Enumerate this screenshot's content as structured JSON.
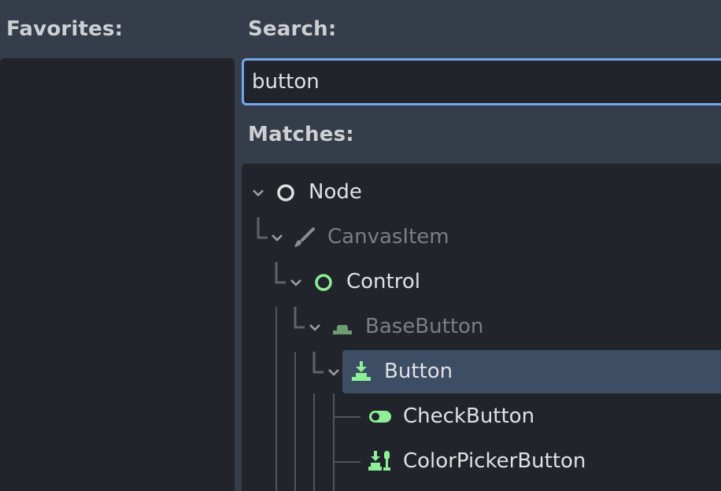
{
  "favorites": {
    "label": "Favorites:"
  },
  "search": {
    "label": "Search:",
    "value": "button"
  },
  "matches": {
    "label": "Matches:",
    "items": [
      {
        "label": "Node",
        "icon": "circle-outline-icon",
        "dim": false
      },
      {
        "label": "CanvasItem",
        "icon": "brush-icon",
        "dim": true
      },
      {
        "label": "Control",
        "icon": "circle-outline-green-icon",
        "dim": false
      },
      {
        "label": "BaseButton",
        "icon": "base-button-icon",
        "dim": true
      },
      {
        "label": "Button",
        "icon": "button-icon",
        "dim": false,
        "selected": true
      },
      {
        "label": "CheckButton",
        "icon": "toggle-icon",
        "dim": false
      },
      {
        "label": "ColorPickerButton",
        "icon": "color-picker-button-icon",
        "dim": false
      }
    ]
  },
  "colors": {
    "background": "#363d4a",
    "panel": "#21252b",
    "accent": "#74a6f0",
    "selection": "#3d4d63",
    "green": "#8eef97"
  }
}
